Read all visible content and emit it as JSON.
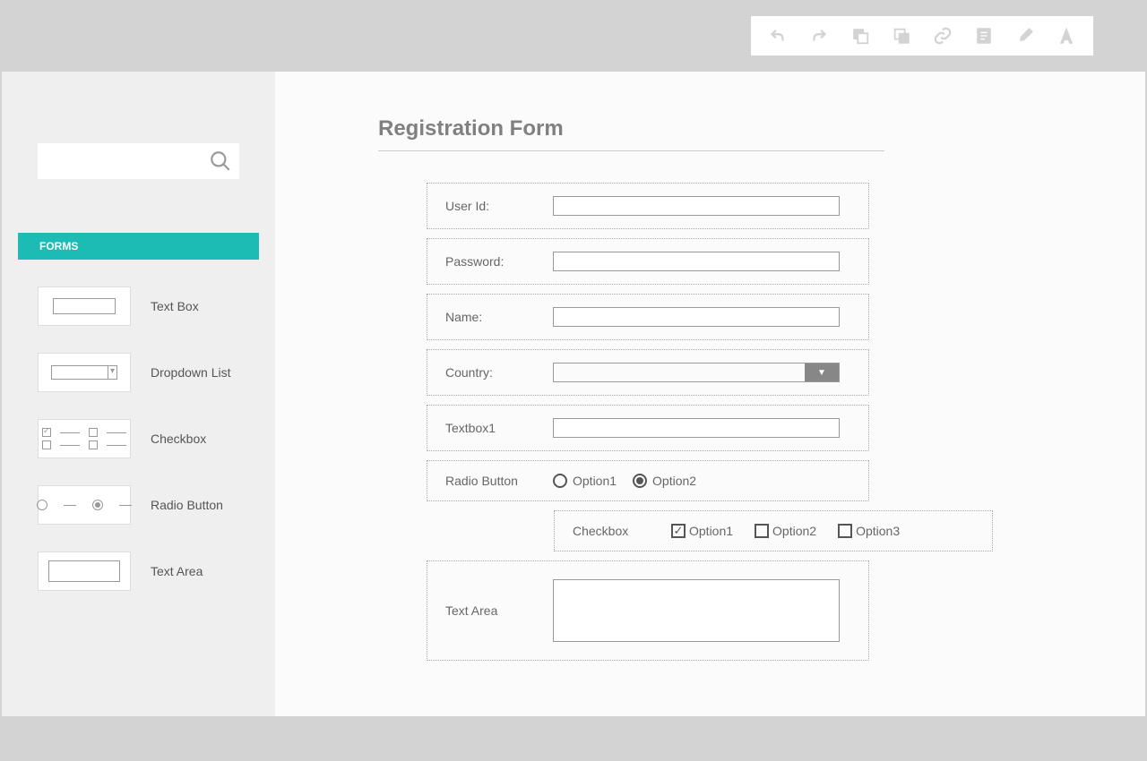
{
  "toolbar": {
    "icons": [
      "undo",
      "redo",
      "copy",
      "paste",
      "link",
      "document",
      "brush",
      "font"
    ]
  },
  "sidebar": {
    "search_placeholder": "",
    "category": "FORMS",
    "items": [
      {
        "label": "Text Box",
        "kind": "textbox"
      },
      {
        "label": "Dropdown List",
        "kind": "dropdown"
      },
      {
        "label": "Checkbox",
        "kind": "checkbox"
      },
      {
        "label": "Radio Button",
        "kind": "radio"
      },
      {
        "label": "Text Area",
        "kind": "textarea"
      }
    ]
  },
  "form": {
    "title": "Registration Form",
    "rows": [
      {
        "label": "User Id:",
        "type": "text"
      },
      {
        "label": "Password:",
        "type": "text"
      },
      {
        "label": "Name:",
        "type": "text"
      },
      {
        "label": "Country:",
        "type": "dropdown"
      },
      {
        "label": "Textbox1",
        "type": "text"
      },
      {
        "label": "Radio Button",
        "type": "radio",
        "options": [
          {
            "label": "Option1",
            "selected": false
          },
          {
            "label": "Option2",
            "selected": true
          }
        ]
      }
    ],
    "checkbox": {
      "label": "Checkbox",
      "options": [
        {
          "label": "Option1",
          "selected": true
        },
        {
          "label": "Option2",
          "selected": false
        },
        {
          "label": "Option3",
          "selected": false
        }
      ]
    },
    "textarea": {
      "label": "Text Area"
    }
  }
}
